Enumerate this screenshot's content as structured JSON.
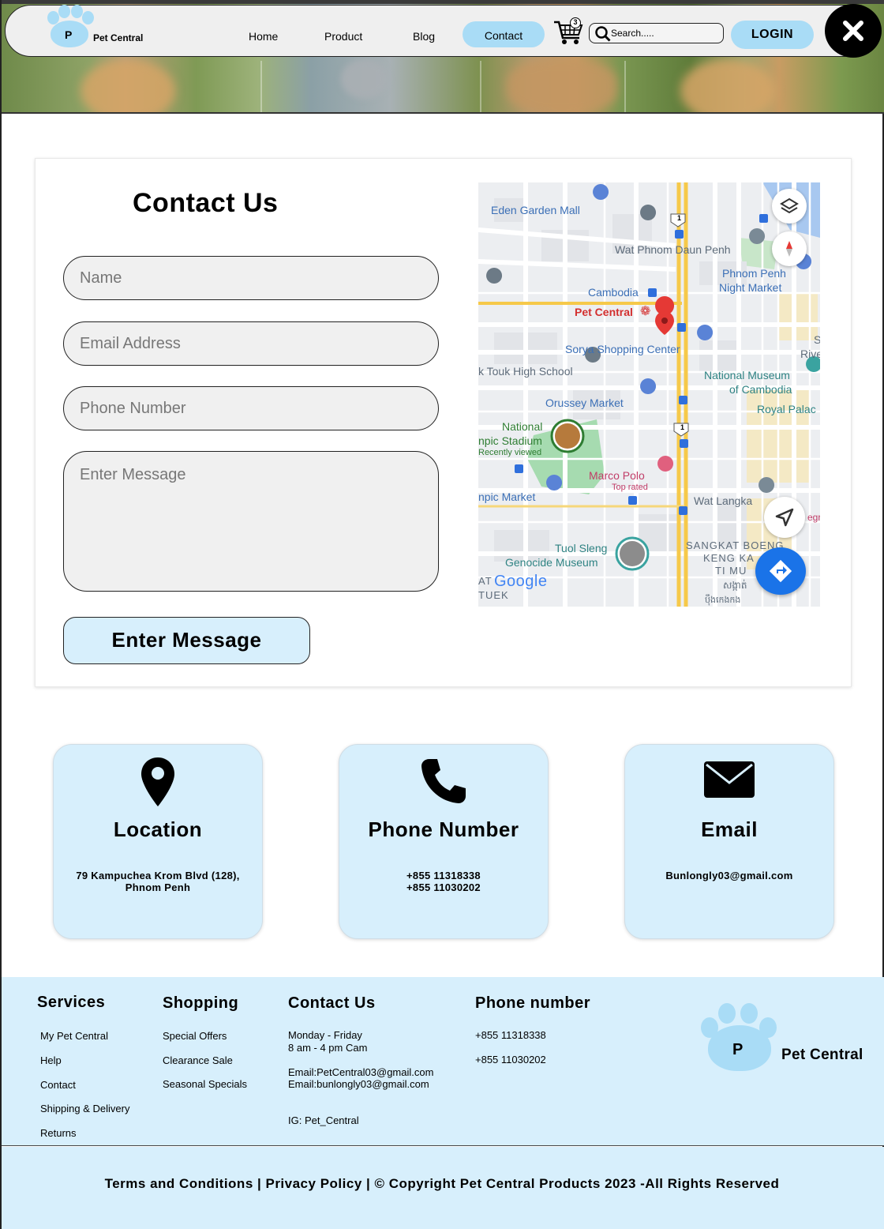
{
  "header": {
    "logo_letter": "P",
    "brand": "Pet Central",
    "nav": [
      {
        "label": "Home"
      },
      {
        "label": "Product"
      },
      {
        "label": "Blog"
      },
      {
        "label": "Contact",
        "active": true
      }
    ],
    "cart_count": "3",
    "search_placeholder": "Search.....",
    "login_label": "LOGIN",
    "close_icon": "close-icon",
    "colors": {
      "accent": "#a9dcf6",
      "light_accent": "#d7effc"
    }
  },
  "contact": {
    "title": "Contact Us",
    "fields": {
      "name_placeholder": "Name",
      "email_placeholder": "Email Address",
      "phone_placeholder": "Phone Number",
      "message_placeholder": "Enter Message"
    },
    "submit_label": "Enter Message"
  },
  "map": {
    "labels": {
      "eden": "Eden Garden Mall",
      "wat_phnom": "Wat Phnom Daun Penh",
      "phnom_penh_market_1": "Phnom Penh",
      "phnom_penh_market_2": "Night Market",
      "cambodia": "Cambodia",
      "pet_central": "Pet Central",
      "sorya": "Sorya Shopping Center",
      "river_1": "S",
      "river_2": "Rive",
      "touk": "k Touk High School",
      "museum_1": "National Museum",
      "museum_2": "of Cambodia",
      "royal": "Royal Palac",
      "orussey": "Orussey Market",
      "national": "National",
      "stadium": "npic Stadium",
      "recently": "Recently viewed",
      "marco": "Marco Polo",
      "top_rated": "Top rated",
      "olympic_market": "npic Market",
      "wat_langka": "Wat Langka",
      "tuol_1": "Tuol Sleng",
      "tuol_2": "Genocide Museum",
      "sangkat_1": "SANGKAT BOENG",
      "sangkat_2": "KENG KA",
      "sangkat_3": "TI MU",
      "google": "Google",
      "at": "AT",
      "tuek": "TUEK",
      "khmer": "សង្កាត់",
      "khmer_2": "ប៉ឹងកេងកង",
      "egr": "egr",
      "route_no": "1"
    }
  },
  "info_cards": [
    {
      "icon": "location-pin-icon",
      "title": "Location",
      "lines": [
        "79 Kampuchea Krom Blvd (128),",
        "Phnom Penh"
      ]
    },
    {
      "icon": "phone-icon",
      "title": "Phone Number",
      "lines": [
        "+855 11318338",
        "+855 11030202"
      ]
    },
    {
      "icon": "envelope-icon",
      "title": "Email",
      "lines": [
        "Bunlongly03@gmail.com"
      ]
    }
  ],
  "footer": {
    "services": {
      "title": "Services",
      "links": [
        "My Pet Central",
        "Help",
        "Contact",
        "Shipping & Delivery",
        "Returns"
      ]
    },
    "shopping": {
      "title": "Shopping",
      "links": [
        "Special Offers",
        "Clearance Sale",
        "Seasonal Specials"
      ]
    },
    "contact": {
      "title": "Contact Us",
      "hours_1": "Monday - Friday",
      "hours_2": "8 am - 4 pm Cam",
      "email_1": "Email:PetCentral03@gmail.com",
      "email_2": "Email:bunlongly03@gmail.com",
      "ig": "IG: Pet_Central"
    },
    "phone": {
      "title": "Phone number",
      "numbers": [
        "+855 11318338",
        "+855 11030202"
      ]
    },
    "logo_letter": "P",
    "brand": "Pet Central",
    "copyright": "Terms and Conditions | Privacy Policy | © Copyright Pet Central Products 2023 -All Rights Reserved"
  }
}
